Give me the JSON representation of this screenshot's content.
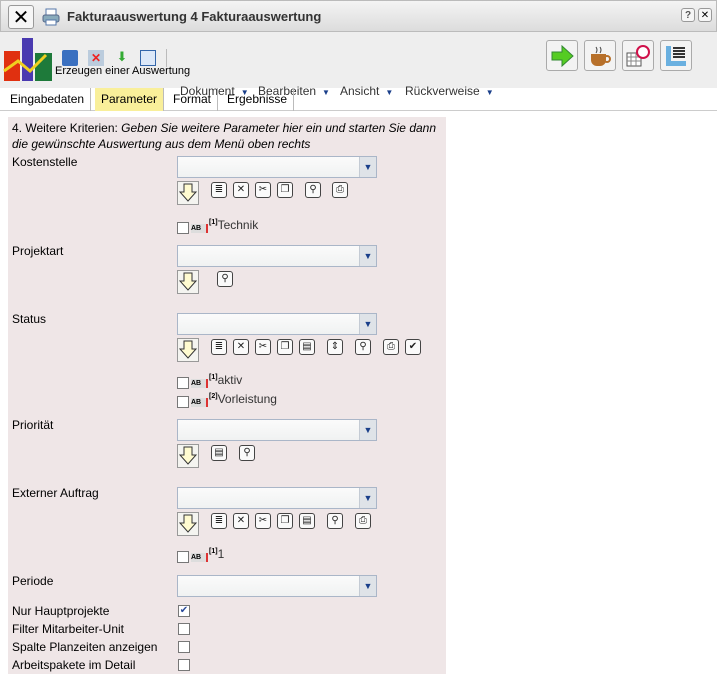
{
  "window": {
    "title": "Fakturaauswertung 4 Fakturaauswertung",
    "help_label": "?",
    "close_label": "✕"
  },
  "toolbar": {
    "subtitle": "Erzeugen einer Auswertung",
    "menus": [
      "Dokument",
      "Bearbeiten",
      "Ansicht",
      "Rückverweise"
    ]
  },
  "tabs": [
    "Eingabedaten",
    "Parameter",
    "Format",
    "Ergebnisse"
  ],
  "active_tab": "Parameter",
  "intro": {
    "prefix": "4. Weitere Kriterien: ",
    "text": "Geben Sie weitere Parameter hier ein und starten Sie dann die gewünschte Auswertung aus dem Menü oben rechts"
  },
  "criteria": [
    {
      "label": "Kostenstelle",
      "value": "",
      "icons": [
        "move-top",
        "delete",
        "cut",
        "copy",
        "search",
        "print"
      ],
      "entries": [
        {
          "index": "[1]",
          "text": "Technik",
          "checked": false
        }
      ]
    },
    {
      "label": "Projektart",
      "value": "",
      "icons": [
        "search"
      ],
      "entries": []
    },
    {
      "label": "Status",
      "value": "",
      "icons": [
        "move-top",
        "delete",
        "cut",
        "copy",
        "paste",
        "sort",
        "search",
        "print",
        "check"
      ],
      "entries": [
        {
          "index": "[1]",
          "text": "aktiv",
          "checked": false
        },
        {
          "index": "[2]",
          "text": "Vorleistung",
          "checked": false
        }
      ]
    },
    {
      "label": "Priorität",
      "value": "",
      "icons": [
        "paste",
        "search"
      ],
      "entries": []
    },
    {
      "label": "Externer Auftrag",
      "value": "",
      "icons": [
        "move-top",
        "delete",
        "cut",
        "copy",
        "paste",
        "search",
        "print"
      ],
      "entries": [
        {
          "index": "[1]",
          "text": "1",
          "checked": false
        }
      ]
    },
    {
      "label": "Periode",
      "value": "",
      "icons": null,
      "entries": []
    }
  ],
  "options": [
    {
      "label": "Nur Hauptprojekte",
      "checked": true
    },
    {
      "label": "Filter Mitarbeiter-Unit",
      "checked": false
    },
    {
      "label": "Spalte Planzeiten anzeigen",
      "checked": false
    },
    {
      "label": "Arbeitspakete im Detail",
      "checked": false
    }
  ]
}
